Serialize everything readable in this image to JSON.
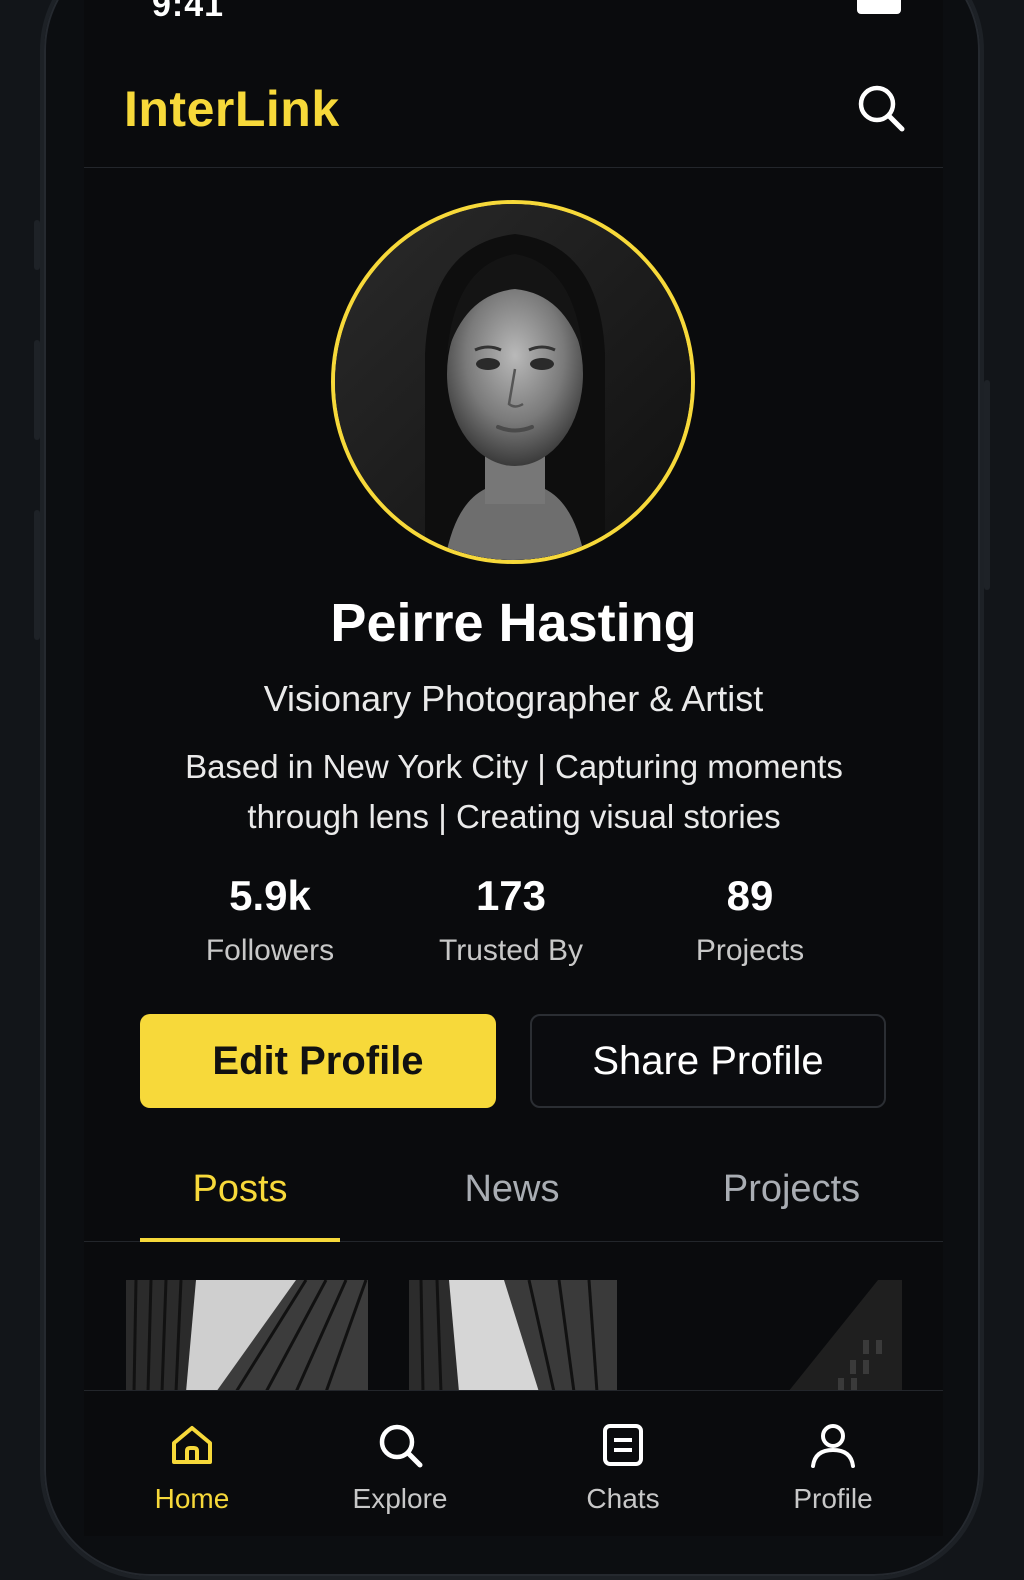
{
  "status_bar": {
    "time": "9:41"
  },
  "header": {
    "brand": "InterLink"
  },
  "profile": {
    "name": "Peirre Hasting",
    "tagline": "Visionary Photographer & Artist",
    "bio": "Based in New York City | Capturing moments through lens | Creating visual stories"
  },
  "stats": [
    {
      "value": "5.9k",
      "label": "Followers"
    },
    {
      "value": "173",
      "label": "Trusted By"
    },
    {
      "value": "89",
      "label": "Projects"
    }
  ],
  "actions": {
    "edit_label": "Edit Profile",
    "share_label": "Share Profile"
  },
  "tabs": [
    {
      "label": "Posts",
      "active": true
    },
    {
      "label": "News",
      "active": false
    },
    {
      "label": "Projects",
      "active": false
    }
  ],
  "bottom_nav": [
    {
      "label": "Home",
      "icon": "home-icon",
      "active": true
    },
    {
      "label": "Explore",
      "icon": "search-icon",
      "active": false
    },
    {
      "label": "Chats",
      "icon": "chat-icon",
      "active": false
    },
    {
      "label": "Profile",
      "icon": "user-icon",
      "active": false
    }
  ],
  "colors": {
    "accent": "#f7d93a",
    "background": "#0a0b0d",
    "text": "#ffffff",
    "muted": "#a9adb3"
  }
}
